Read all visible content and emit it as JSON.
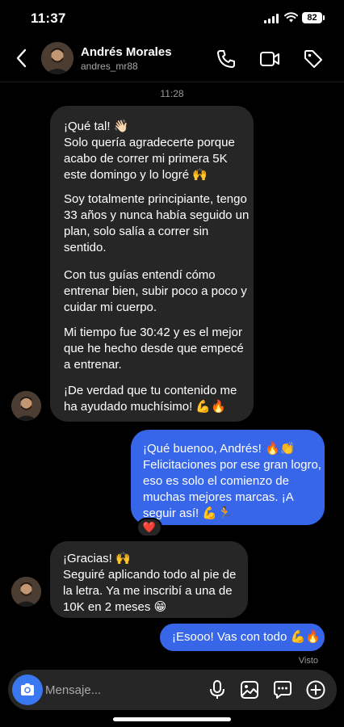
{
  "status_bar": {
    "time": "11:37",
    "battery": "82"
  },
  "header": {
    "name": "Andrés Morales",
    "username": "andres_mr88"
  },
  "conversation": {
    "timestamp": "11:28",
    "messages": [
      {
        "from": "them",
        "paragraphs": [
          "¡Qué tal! 👋🏻\nSolo quería agradecerte porque acabo de correr mi primera 5K este domingo y lo logré 🙌",
          "Soy totalmente principiante, tengo 33 años y nunca había seguido un plan, solo salía a correr sin sentido.",
          "Con tus guías entendí cómo entrenar bien, subir poco a poco y cuidar mi cuerpo.",
          "Mi tiempo fue 30:42 y es el mejor que he hecho desde que empecé a entrenar.",
          "¡De verdad que tu contenido me ha ayudado muchísimo! 💪🔥"
        ]
      },
      {
        "from": "me",
        "paragraphs": [
          "¡Qué buenoo, Andrés! 🔥👏\nFelicitaciones por ese gran logro, eso es solo el comienzo de muchas mejores marcas. ¡A seguir así! 💪🏃"
        ],
        "reaction": "❤️"
      },
      {
        "from": "them",
        "paragraphs": [
          "¡Gracias! 🙌\nSeguiré aplicando todo al pie de la letra. Ya me inscribí a una de 10K en 2 meses 😁"
        ]
      },
      {
        "from": "me",
        "paragraphs": [
          "¡Esooo! Vas con todo 💪🔥"
        ]
      }
    ],
    "seen_label": "Visto"
  },
  "composer": {
    "placeholder": "Mensaje..."
  },
  "icons": {
    "back": "chevron-left-icon",
    "call": "phone-icon",
    "video": "video-camera-icon",
    "tag": "tag-icon",
    "camera": "camera-icon",
    "mic": "microphone-icon",
    "gallery": "image-icon",
    "sticker": "chat-bubble-icon",
    "add": "plus-circle-icon"
  },
  "colors": {
    "outgoing_bubble": "#3766e8",
    "incoming_bubble": "#262626",
    "camera_button": "#3a78f2"
  }
}
